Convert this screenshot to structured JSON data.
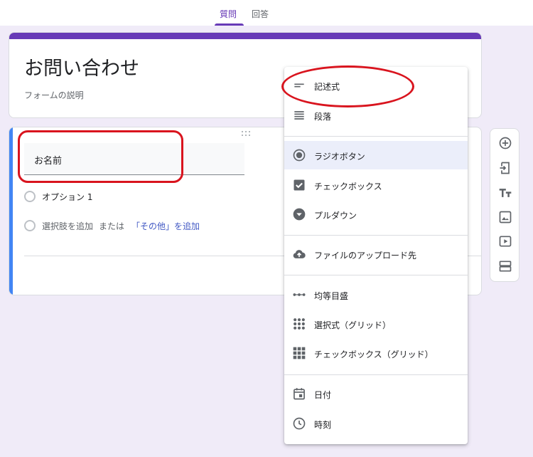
{
  "tabs": [
    {
      "label": "質問",
      "active": true
    },
    {
      "label": "回答",
      "active": false
    }
  ],
  "form": {
    "title": "お問い合わせ",
    "description": "フォームの説明"
  },
  "question": {
    "title_value": "お名前",
    "option1": "オプション 1",
    "add_option": "選択肢を追加",
    "or_text": "または",
    "add_other": "「その他」を追加"
  },
  "menu": {
    "items": [
      {
        "label": "記述式",
        "icon": "short-answer-icon"
      },
      {
        "label": "段落",
        "icon": "paragraph-icon"
      },
      {
        "label": "ラジオボタン",
        "icon": "radio-button-icon"
      },
      {
        "label": "チェックボックス",
        "icon": "checkbox-icon"
      },
      {
        "label": "プルダウン",
        "icon": "dropdown-icon"
      },
      {
        "label": "ファイルのアップロード先",
        "icon": "cloud-upload-icon"
      },
      {
        "label": "均等目盛",
        "icon": "linear-scale-icon"
      },
      {
        "label": "選択式（グリッド）",
        "icon": "multiple-choice-grid-icon"
      },
      {
        "label": "チェックボックス（グリッド）",
        "icon": "checkbox-grid-icon"
      },
      {
        "label": "日付",
        "icon": "calendar-icon"
      },
      {
        "label": "時刻",
        "icon": "clock-icon"
      }
    ],
    "selected_index": 2
  },
  "toolbar": {
    "icons": [
      "add-question-icon",
      "import-questions-icon",
      "add-title-icon",
      "add-image-icon",
      "add-video-icon",
      "add-section-icon"
    ]
  },
  "colors": {
    "accent": "#673ab7",
    "background": "#f0ebf8",
    "active_question": "#4285f4",
    "highlight_ring": "#d9141e",
    "link": "#4259c4"
  }
}
